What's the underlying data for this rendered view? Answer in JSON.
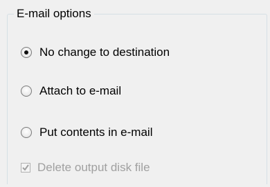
{
  "group": {
    "title": "E-mail options"
  },
  "options": {
    "no_change": {
      "label": "No change to destination",
      "selected": true
    },
    "attach": {
      "label": "Attach to e-mail",
      "selected": false
    },
    "put_contents": {
      "label": "Put contents in e-mail",
      "selected": false
    }
  },
  "delete_output": {
    "label": "Delete output disk file",
    "checked": true,
    "enabled": false
  }
}
